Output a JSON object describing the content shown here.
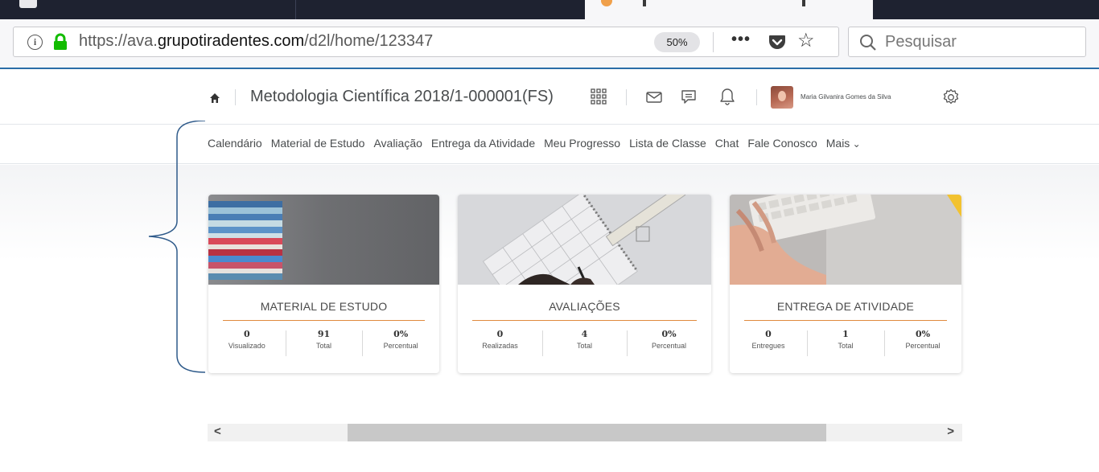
{
  "browser": {
    "url_prefix": "https://ava.",
    "url_host": "grupotiradentes.com",
    "url_path": "/d2l/home/123347",
    "zoom": "50%",
    "menu_dots": "•••",
    "search_placeholder": "Pesquisar"
  },
  "header": {
    "course_title": "Metodologia Científica 2018/1-000001(FS)",
    "user_name": "Maria Gilvanira Gomes da Silva"
  },
  "nav": {
    "items": [
      "Calendário",
      "Material de Estudo",
      "Avaliação",
      "Entrega da Atividade",
      "Meu Progresso",
      "Lista de Classe",
      "Chat",
      "Fale Conosco",
      "Mais"
    ]
  },
  "cards": [
    {
      "title": "MATERIAL DE ESTUDO",
      "stats": [
        {
          "value": "0",
          "label": "Visualizado"
        },
        {
          "value": "91",
          "label": "Total"
        },
        {
          "value": "0%",
          "label": "Percentual"
        }
      ]
    },
    {
      "title": "AVALIAÇÕES",
      "stats": [
        {
          "value": "0",
          "label": "Realizadas"
        },
        {
          "value": "4",
          "label": "Total"
        },
        {
          "value": "0%",
          "label": "Percentual"
        }
      ]
    },
    {
      "title": "ENTREGA DE ATIVIDADE",
      "stats": [
        {
          "value": "0",
          "label": "Entregues"
        },
        {
          "value": "1",
          "label": "Total"
        },
        {
          "value": "0%",
          "label": "Percentual"
        }
      ]
    }
  ],
  "scrollbar": {
    "left_arrow": "<",
    "right_arrow": ">"
  },
  "colors": {
    "accent_rule": "#e08a3d",
    "browser_dark": "#1e2230",
    "focus_line": "#2b6ea8",
    "lock_green": "#12bc00"
  }
}
